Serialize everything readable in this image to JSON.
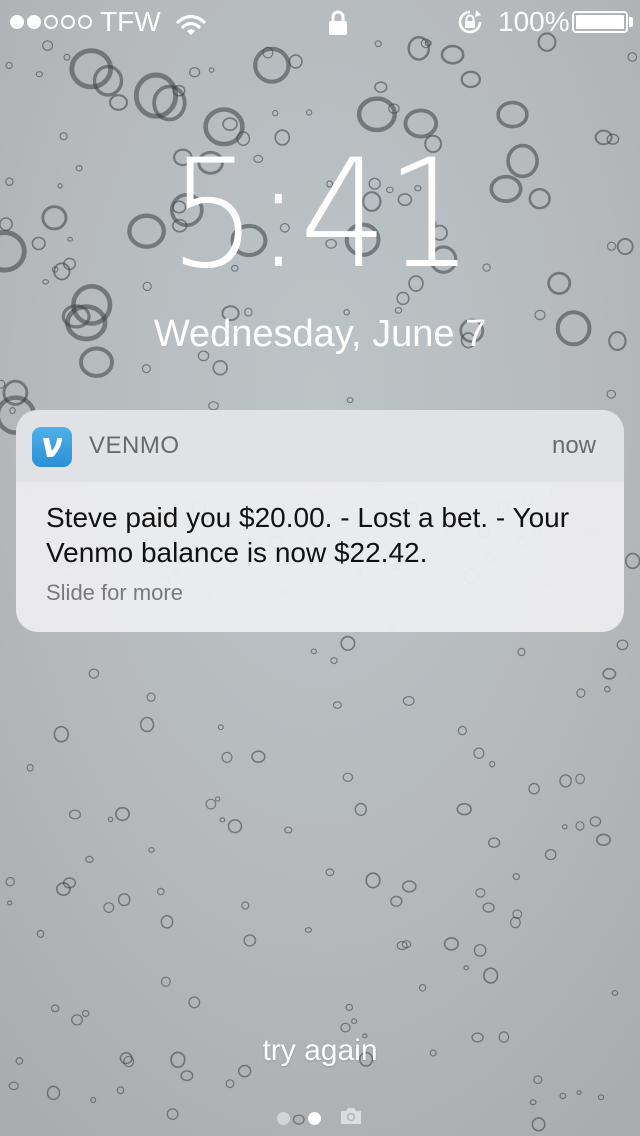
{
  "status_bar": {
    "signal_filled": 2,
    "signal_total": 5,
    "carrier": "TFW",
    "wifi_icon": "wifi-icon",
    "lock_icon": "padlock-icon",
    "rotation_lock_icon": "rotation-lock-icon",
    "battery_percent": "100%",
    "battery_level": 1.0
  },
  "lock_screen": {
    "time": "5:41",
    "date": "Wednesday, June 7"
  },
  "notification": {
    "app_name": "VENMO",
    "app_icon": "venmo-v-icon",
    "time": "now",
    "message": "Steve paid you $20.00. - Lost a bet. - Your Venmo balance is now $22.42.",
    "hint": "Slide for more"
  },
  "bottom": {
    "hint_text": "try again",
    "pages": 2,
    "active_page": 2,
    "camera_icon": "camera-icon"
  },
  "colors": {
    "venmo_blue": "#3d95ce",
    "text_white": "#ffffff"
  }
}
